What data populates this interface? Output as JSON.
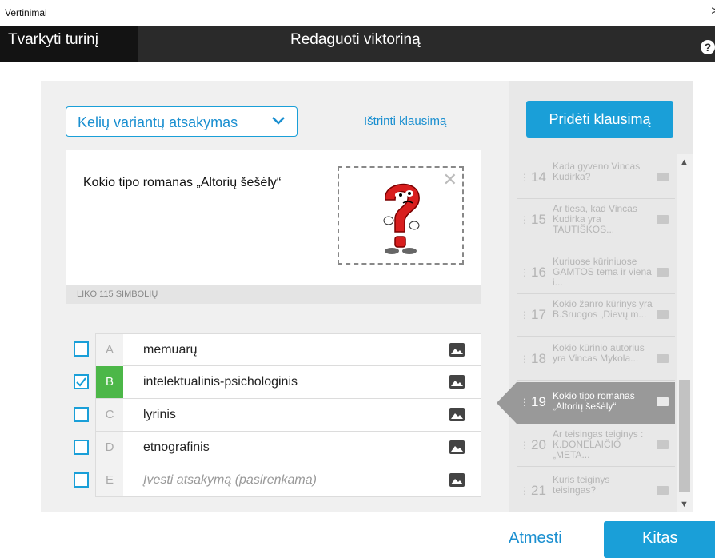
{
  "window": {
    "title": "Vertinimai",
    "close_glyph": ">"
  },
  "topbar": {
    "tab_manage": "Tvarkyti turinį",
    "tab_edit": "Redaguoti viktoriną",
    "help_glyph": "?"
  },
  "editor": {
    "question_type": "Kelių variantų atsakymas",
    "delete_question": "Ištrinti klausimą",
    "question_text": "Kokio tipo romanas „Altorių šešėly“",
    "chars_left": "LIKO 115 SIMBOLIŲ",
    "remove_image_glyph": "✕",
    "answers": [
      {
        "letter": "A",
        "text": "memuarų",
        "correct": false,
        "placeholder": false
      },
      {
        "letter": "B",
        "text": "intelektualinis-psichologinis",
        "correct": true,
        "placeholder": false
      },
      {
        "letter": "C",
        "text": "lyrinis",
        "correct": false,
        "placeholder": false
      },
      {
        "letter": "D",
        "text": "etnografinis",
        "correct": false,
        "placeholder": false
      },
      {
        "letter": "E",
        "text": "Įvesti atsakymą (pasirenkama)",
        "correct": false,
        "placeholder": true
      }
    ]
  },
  "sidebar": {
    "add_question": "Pridėti klausimą",
    "questions": [
      {
        "num": "14",
        "text": "Kada gyveno Vincas Kudirka?",
        "active": false
      },
      {
        "num": "15",
        "text": "Ar tiesa, kad Vincas Kudirka yra TAUTIŠKOS...",
        "active": false
      },
      {
        "num": "16",
        "text": "Kuriuose kūriniuose GAMTOS tema ir viena i...",
        "active": false
      },
      {
        "num": "17",
        "text": "Kokio žanro kūrinys yra B.Sruogos „Dievų m...",
        "active": false
      },
      {
        "num": "18",
        "text": "Kokio kūrinio autorius yra Vincas Mykola...",
        "active": false
      },
      {
        "num": "19",
        "text": "Kokio tipo romanas „Altorių šešėly“",
        "active": true
      },
      {
        "num": "20",
        "text": "Ar teisingas teiginys : K.DONELAIČIO „META...",
        "active": false
      },
      {
        "num": "21",
        "text": "Kuris teiginys teisingas?",
        "active": false
      }
    ]
  },
  "footer": {
    "reject": "Atmesti",
    "next": "Kitas"
  },
  "colors": {
    "accent": "#1a9fd8",
    "correct": "#4cb748",
    "active_item": "#999999",
    "topbar": "#2a2a2a"
  }
}
